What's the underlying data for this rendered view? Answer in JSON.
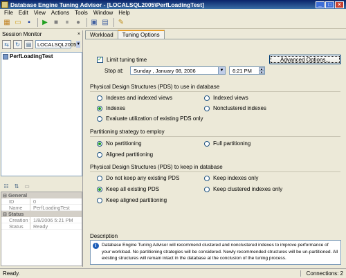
{
  "window": {
    "title": "Database Engine Tuning Advisor - [LOCALSQL2005\\PerfLoadingTest]"
  },
  "menu": [
    "File",
    "Edit",
    "View",
    "Actions",
    "Tools",
    "Window",
    "Help"
  ],
  "session_monitor": {
    "title": "Session Monitor",
    "server": "LOCALSQL2005",
    "sessions": [
      "PerfLoadingTest"
    ]
  },
  "properties": {
    "general": {
      "label": "General",
      "rows": [
        {
          "k": "ID",
          "v": "0"
        },
        {
          "k": "Name",
          "v": "PerfLoadingTest"
        }
      ]
    },
    "status": {
      "label": "Status",
      "rows": [
        {
          "k": "Creation time",
          "v": "1/8/2006 5:21 PM"
        },
        {
          "k": "Status",
          "v": "Ready"
        }
      ]
    }
  },
  "tabs": [
    "Workload",
    "Tuning Options"
  ],
  "tuning": {
    "limit_label": "Limit tuning time",
    "stop_at_label": "Stop at:",
    "date": "Sunday    ,   January   08, 2006",
    "time": "6:21 PM",
    "advanced_button": "Advanced Options...",
    "pds_use_title": "Physical Design Structures (PDS) to use in database",
    "pds_use": {
      "indexes_views": "Indexes and indexed views",
      "indexed_views": "Indexed views",
      "indexes": "Indexes",
      "nonclustered": "Nonclustered indexes",
      "evaluate": "Evaluate utilization of existing PDS only"
    },
    "partition_title": "Partitioning strategy to employ",
    "partition": {
      "none": "No partitioning",
      "full": "Full partitioning",
      "aligned": "Aligned partitioning"
    },
    "pds_keep_title": "Physical Design Structures (PDS) to keep in database",
    "pds_keep": {
      "none": "Do not keep any existing PDS",
      "indexes_only": "Keep indexes only",
      "all": "Keep all existing PDS",
      "clustered": "Keep clustered indexes only",
      "aligned": "Keep aligned partitioning"
    },
    "description_label": "Description",
    "description": "Database Engine Tuning Advisor will recommend clustered and nonclustered indexes to improve performance of your workload. No partitioning strategies will be considered. Newly recommended structures will be un-partitioned. All existing structures will remain intact in the database at the conclusion of the tuning process."
  },
  "status": {
    "left": "Ready.",
    "right": "Connections: 2"
  }
}
